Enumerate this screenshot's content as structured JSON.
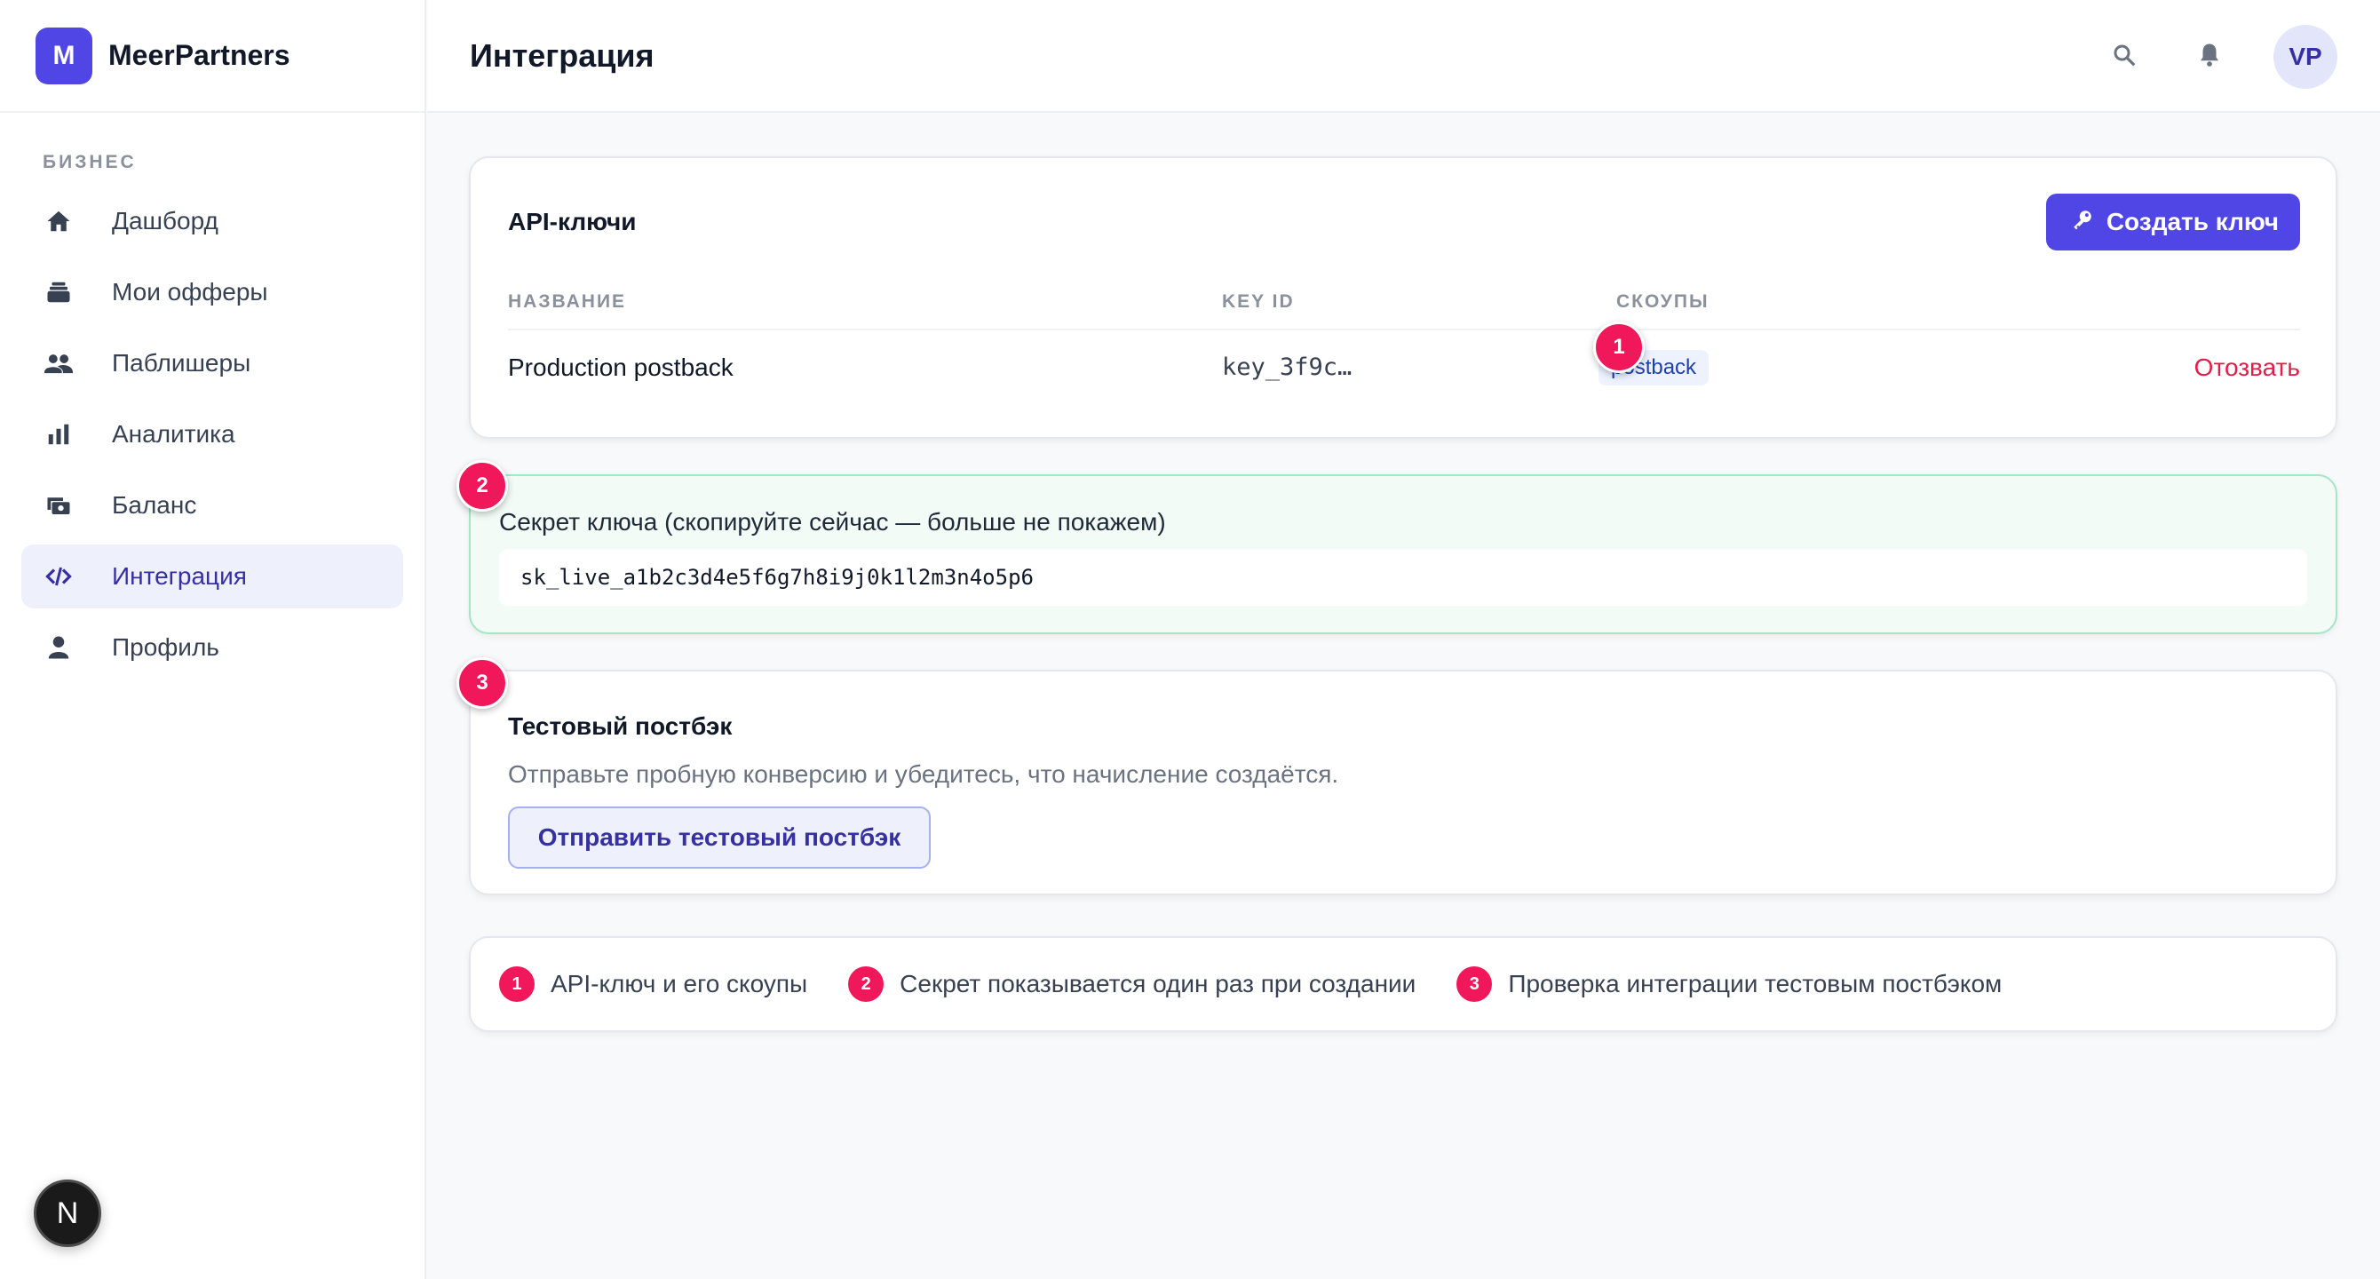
{
  "brand": {
    "logo_letter": "M",
    "name": "MeerPartners"
  },
  "sidebar": {
    "section_label": "БИЗНЕС",
    "items": [
      {
        "label": "Дашборд",
        "icon": "home-icon"
      },
      {
        "label": "Мои офферы",
        "icon": "offers-icon"
      },
      {
        "label": "Паблишеры",
        "icon": "users-icon"
      },
      {
        "label": "Аналитика",
        "icon": "bar-chart-icon"
      },
      {
        "label": "Баланс",
        "icon": "wallet-icon"
      },
      {
        "label": "Интеграция",
        "icon": "code-icon",
        "active": true
      },
      {
        "label": "Профиль",
        "icon": "person-icon"
      }
    ],
    "footer_badge": "N"
  },
  "header": {
    "title": "Интеграция",
    "avatar_initials": "VP"
  },
  "api_keys": {
    "title": "API-ключи",
    "create_button": "Создать ключ",
    "columns": [
      "НАЗВАНИЕ",
      "KEY ID",
      "СКОУПЫ"
    ],
    "rows": [
      {
        "name": "Production postback",
        "key_id": "key_3f9c…",
        "scope": "postback",
        "action": "Отозвать"
      }
    ]
  },
  "secret": {
    "label": "Секрет ключа (скопируйте сейчас — больше не покажем)",
    "value": "sk_live_a1b2c3d4e5f6g7h8i9j0k1l2m3n4o5p6"
  },
  "test": {
    "title": "Тестовый постбэк",
    "description": "Отправьте пробную конверсию и убедитесь, что начисление создаётся.",
    "button": "Отправить тестовый постбэк"
  },
  "markers": [
    "1",
    "2",
    "3"
  ],
  "legend": [
    {
      "num": "1",
      "text": "API-ключ и его скоупы"
    },
    {
      "num": "2",
      "text": "Секрет показывается один раз при создании"
    },
    {
      "num": "3",
      "text": "Проверка интеграции тестовым постбэком"
    }
  ],
  "colors": {
    "accent": "#4f46e5",
    "marker": "#f0185a",
    "danger": "#e11d48",
    "success_bg": "#f2fbf6"
  }
}
